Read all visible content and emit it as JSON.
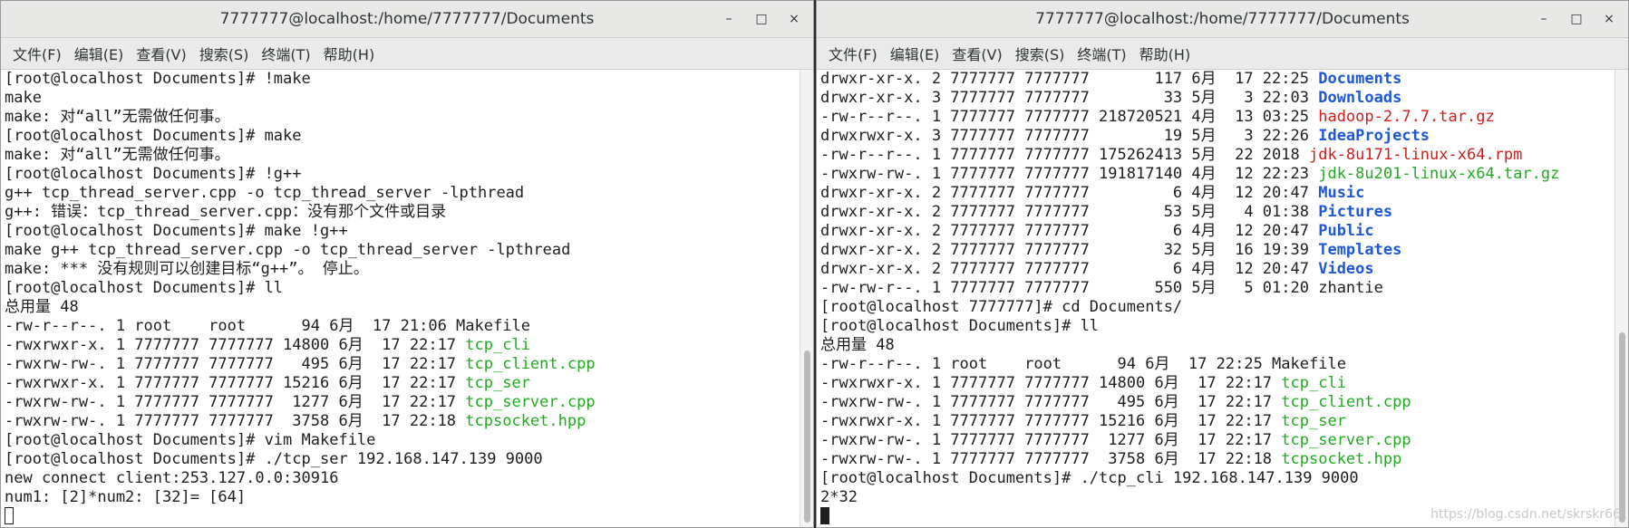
{
  "left_window": {
    "title": "7777777@localhost:/home/7777777/Documents",
    "menu": [
      "文件(F)",
      "编辑(E)",
      "查看(V)",
      "搜索(S)",
      "终端(T)",
      "帮助(H)"
    ],
    "lines": [
      [
        {
          "t": "[root@localhost Documents]# !make"
        }
      ],
      [
        {
          "t": "make"
        }
      ],
      [
        {
          "t": "make: 对“all”无需做任何事。"
        }
      ],
      [
        {
          "t": "[root@localhost Documents]# make"
        }
      ],
      [
        {
          "t": "make: 对“all”无需做任何事。"
        }
      ],
      [
        {
          "t": "[root@localhost Documents]# !g++"
        }
      ],
      [
        {
          "t": "g++ tcp_thread_server.cpp -o tcp_thread_server -lpthread"
        }
      ],
      [
        {
          "t": "g++: 错误：tcp_thread_server.cpp：没有那个文件或目录"
        }
      ],
      [
        {
          "t": "[root@localhost Documents]# make !g++"
        }
      ],
      [
        {
          "t": "make g++ tcp_thread_server.cpp -o tcp_thread_server -lpthread"
        }
      ],
      [
        {
          "t": "make: *** 没有规则可以创建目标“g++”。 停止。"
        }
      ],
      [
        {
          "t": "[root@localhost Documents]# ll"
        }
      ],
      [
        {
          "t": "总用量 48"
        }
      ],
      [
        {
          "t": "-rw-r--r--. 1 root    root      94 6月  17 21:06 "
        },
        {
          "t": "Makefile"
        }
      ],
      [
        {
          "t": "-rwxrwxr-x. 1 7777777 7777777 14800 6月  17 22:17 "
        },
        {
          "t": "tcp_cli",
          "c": "green"
        }
      ],
      [
        {
          "t": "-rwxrw-rw-. 1 7777777 7777777   495 6月  17 22:17 "
        },
        {
          "t": "tcp_client.cpp",
          "c": "green"
        }
      ],
      [
        {
          "t": "-rwxrwxr-x. 1 7777777 7777777 15216 6月  17 22:17 "
        },
        {
          "t": "tcp_ser",
          "c": "green"
        }
      ],
      [
        {
          "t": "-rwxrw-rw-. 1 7777777 7777777  1277 6月  17 22:17 "
        },
        {
          "t": "tcp_server.cpp",
          "c": "green"
        }
      ],
      [
        {
          "t": "-rwxrw-rw-. 1 7777777 7777777  3758 6月  17 22:18 "
        },
        {
          "t": "tcpsocket.hpp",
          "c": "green"
        }
      ],
      [
        {
          "t": "[root@localhost Documents]# vim Makefile"
        }
      ],
      [
        {
          "t": "[root@localhost Documents]# ./tcp_ser 192.168.147.139 9000"
        }
      ],
      [
        {
          "t": "new connect client:253.127.0.0:30916"
        }
      ],
      [
        {
          "t": "num1: [2]*num2: [32]= [64]"
        }
      ]
    ]
  },
  "right_window": {
    "title": "7777777@localhost:/home/7777777/Documents",
    "menu": [
      "文件(F)",
      "编辑(E)",
      "查看(V)",
      "搜索(S)",
      "终端(T)",
      "帮助(H)"
    ],
    "lines": [
      [
        {
          "t": "drwxr-xr-x. 2 7777777 7777777       117 6月  17 22:25 "
        },
        {
          "t": "Documents",
          "c": "blue"
        }
      ],
      [
        {
          "t": "drwxr-xr-x. 3 7777777 7777777        33 5月   3 22:03 "
        },
        {
          "t": "Downloads",
          "c": "blue"
        }
      ],
      [
        {
          "t": "-rw-r--r--. 1 7777777 7777777 218720521 4月  13 03:25 "
        },
        {
          "t": "hadoop-2.7.7.tar.gz",
          "c": "red"
        }
      ],
      [
        {
          "t": "drwxrwxr-x. 3 7777777 7777777        19 5月   3 22:26 "
        },
        {
          "t": "IdeaProjects",
          "c": "blue"
        }
      ],
      [
        {
          "t": "-rw-r--r--. 1 7777777 7777777 175262413 5月  22 2018 "
        },
        {
          "t": "jdk-8u171-linux-x64.rpm",
          "c": "red"
        }
      ],
      [
        {
          "t": "-rwxrw-rw-. 1 7777777 7777777 191817140 4月  12 22:23 "
        },
        {
          "t": "jdk-8u201-linux-x64.tar.gz",
          "c": "green"
        }
      ],
      [
        {
          "t": "drwxr-xr-x. 2 7777777 7777777         6 4月  12 20:47 "
        },
        {
          "t": "Music",
          "c": "blue"
        }
      ],
      [
        {
          "t": "drwxr-xr-x. 2 7777777 7777777        53 5月   4 01:38 "
        },
        {
          "t": "Pictures",
          "c": "blue"
        }
      ],
      [
        {
          "t": "drwxr-xr-x. 2 7777777 7777777         6 4月  12 20:47 "
        },
        {
          "t": "Public",
          "c": "blue"
        }
      ],
      [
        {
          "t": "drwxr-xr-x. 2 7777777 7777777        32 5月  16 19:39 "
        },
        {
          "t": "Templates",
          "c": "blue"
        }
      ],
      [
        {
          "t": "drwxr-xr-x. 2 7777777 7777777         6 4月  12 20:47 "
        },
        {
          "t": "Videos",
          "c": "blue"
        }
      ],
      [
        {
          "t": "-rw-rw-r--. 1 7777777 7777777       550 5月   5 01:20 "
        },
        {
          "t": "zhantie"
        }
      ],
      [
        {
          "t": "[root@localhost 7777777]# cd Documents/"
        }
      ],
      [
        {
          "t": "[root@localhost Documents]# ll"
        }
      ],
      [
        {
          "t": "总用量 48"
        }
      ],
      [
        {
          "t": "-rw-r--r--. 1 root    root      94 6月  17 22:25 "
        },
        {
          "t": "Makefile"
        }
      ],
      [
        {
          "t": "-rwxrwxr-x. 1 7777777 7777777 14800 6月  17 22:17 "
        },
        {
          "t": "tcp_cli",
          "c": "green"
        }
      ],
      [
        {
          "t": "-rwxrw-rw-. 1 7777777 7777777   495 6月  17 22:17 "
        },
        {
          "t": "tcp_client.cpp",
          "c": "green"
        }
      ],
      [
        {
          "t": "-rwxrwxr-x. 1 7777777 7777777 15216 6月  17 22:17 "
        },
        {
          "t": "tcp_ser",
          "c": "green"
        }
      ],
      [
        {
          "t": "-rwxrw-rw-. 1 7777777 7777777  1277 6月  17 22:17 "
        },
        {
          "t": "tcp_server.cpp",
          "c": "green"
        }
      ],
      [
        {
          "t": "-rwxrw-rw-. 1 7777777 7777777  3758 6月  17 22:18 "
        },
        {
          "t": "tcpsocket.hpp",
          "c": "green"
        }
      ],
      [
        {
          "t": "[root@localhost Documents]# ./tcp_cli 192.168.147.139 9000"
        }
      ],
      [
        {
          "t": "2*32"
        }
      ]
    ]
  },
  "controls": {
    "minimize_glyph": "–",
    "maximize_glyph": "□",
    "close_glyph": "×"
  },
  "watermark": "https://blog.csdn.net/skrskr66",
  "colors": {
    "green": "#22aa22",
    "blue": "#1f57d9",
    "red": "#d21c1c"
  }
}
